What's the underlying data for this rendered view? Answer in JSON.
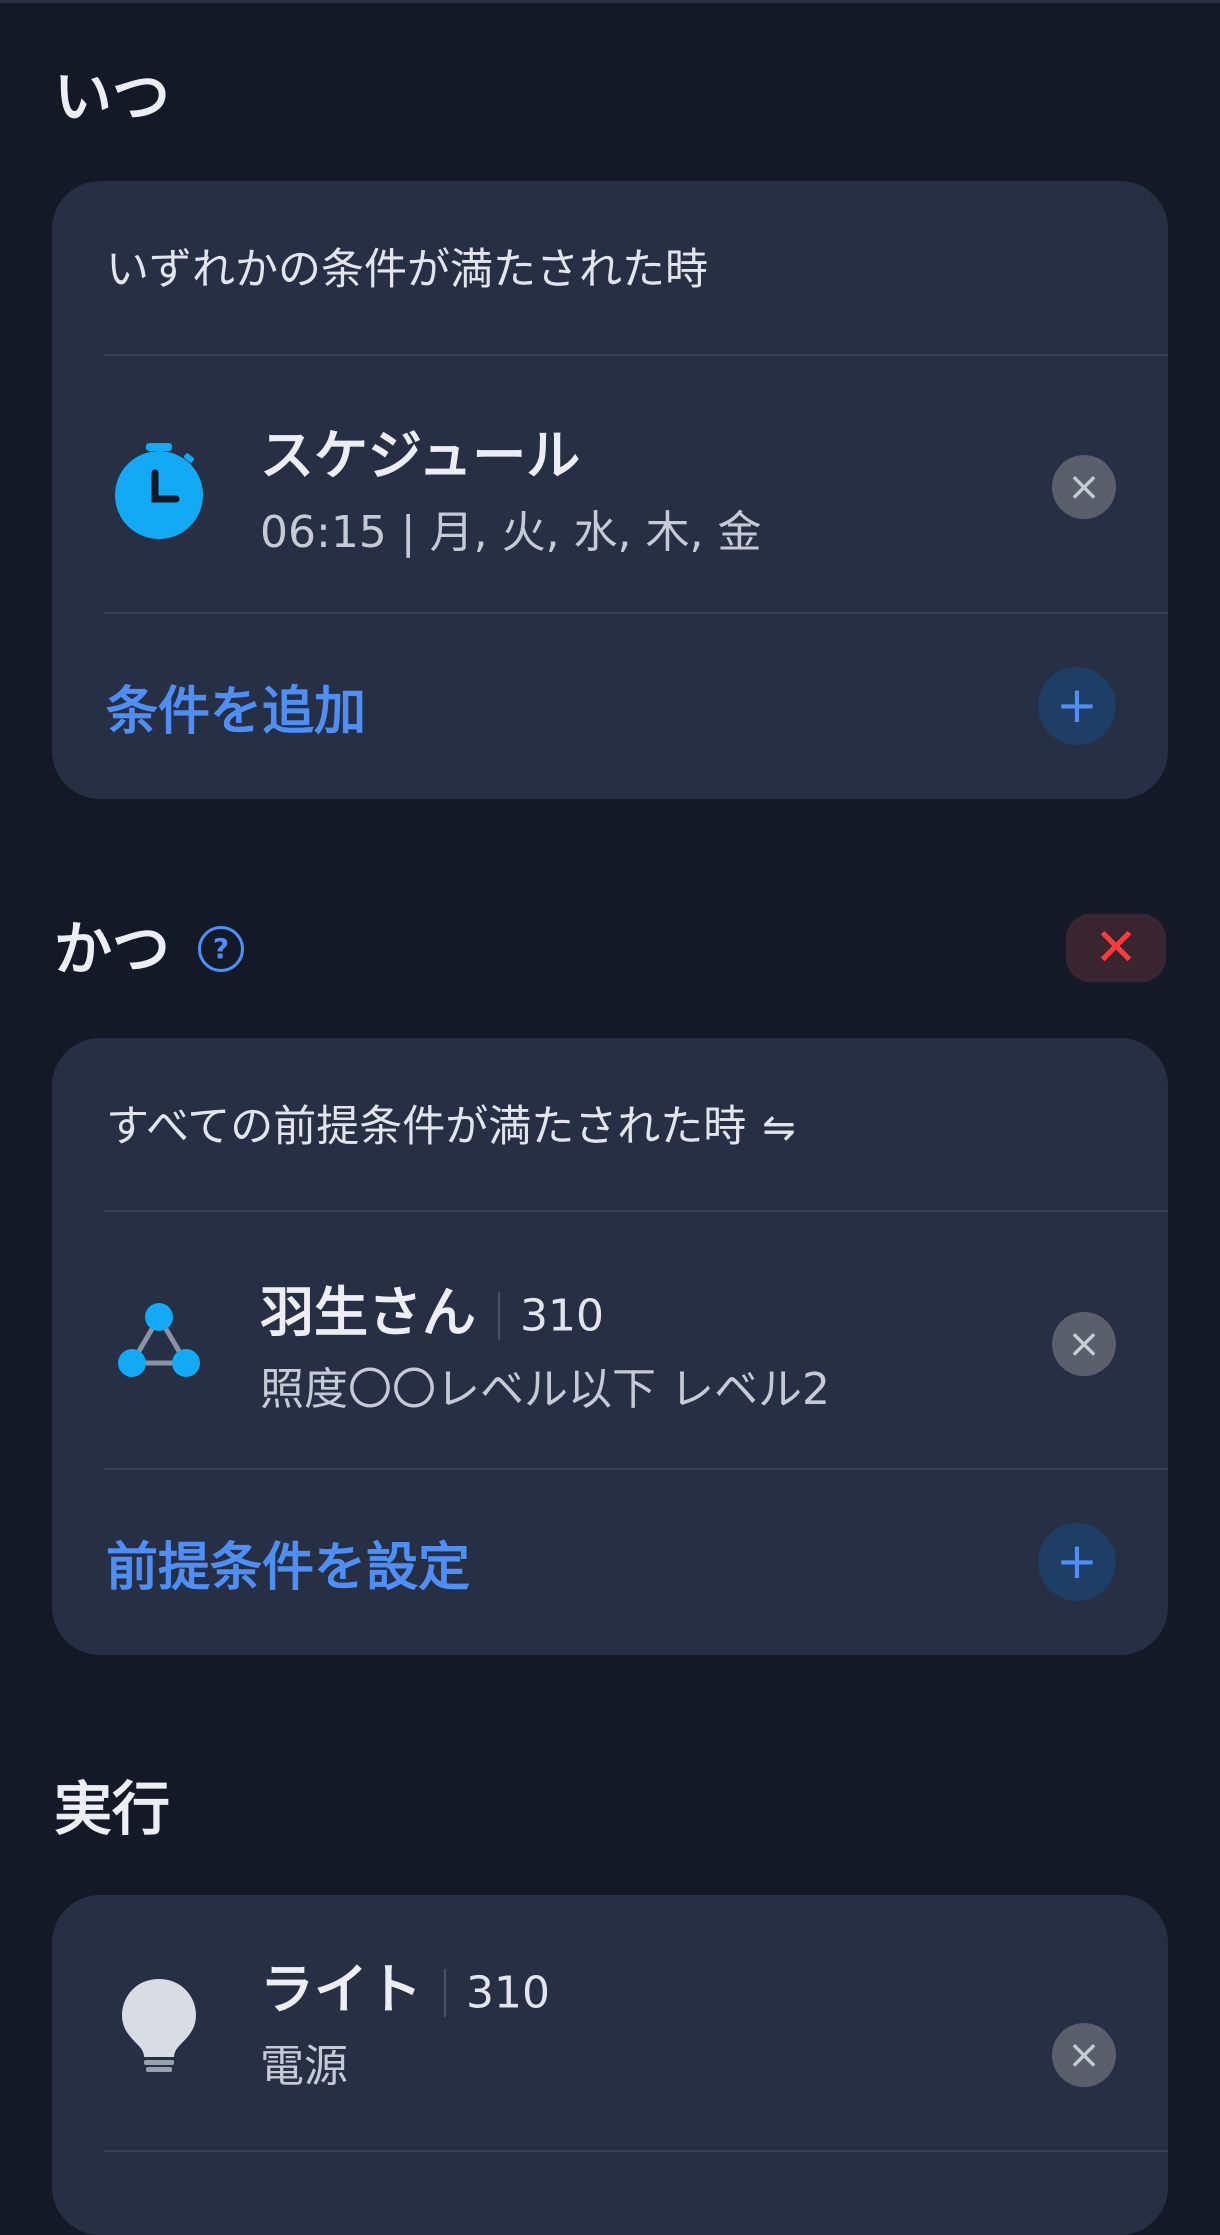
{
  "when": {
    "title": "いつ",
    "card_header": "いずれかの条件が満たされた時",
    "items": [
      {
        "icon": "timer-icon",
        "title": "スケジュール",
        "subtitle": "06:15 | 月, 火, 水, 木, 金"
      }
    ],
    "add_label": "条件を追加"
  },
  "and": {
    "title": "かつ",
    "help_icon": "?",
    "card_header": "すべての前提条件が満たされた時",
    "items": [
      {
        "icon": "hub-icon",
        "title": "羽生さん",
        "count": "310",
        "subtitle": "照度〇〇レベル以下 レベル2"
      }
    ],
    "add_label": "前提条件を設定"
  },
  "execute": {
    "title": "実行",
    "items": [
      {
        "icon": "light-bulb-icon",
        "title": "ライト",
        "count": "310",
        "subtitle": "電源"
      }
    ]
  },
  "colors": {
    "accent": "#4f8ff5",
    "icon_blue": "#12a9f5",
    "danger": "#ff3b3b"
  }
}
